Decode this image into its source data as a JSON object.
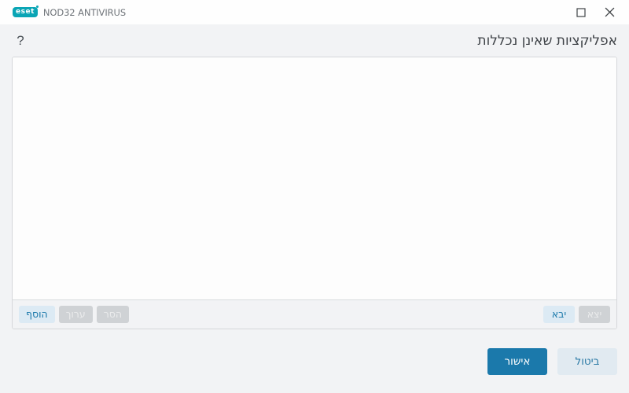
{
  "titlebar": {
    "close_label": "close-icon",
    "maximize_label": "maximize-icon",
    "brand_logo_text": "eset",
    "brand_product": "NOD32 ANTIVIRUS",
    "brand_color": "#0aa5b5",
    "background": "#fefefe"
  },
  "header": {
    "title": "אפליקציות שאינן נכללות",
    "help_label": "?"
  },
  "panel": {
    "list": {
      "items": [],
      "empty": ""
    },
    "toolbar": {
      "right_group": [
        {
          "label": "הוסף",
          "state": "enabled"
        },
        {
          "label": "ערוך",
          "state": "disabled"
        },
        {
          "label": "הסר",
          "state": "disabled"
        }
      ],
      "left_group": [
        {
          "label": "יבא",
          "state": "enabled"
        },
        {
          "label": "יצא",
          "state": "disabled"
        }
      ]
    }
  },
  "footer": {
    "confirm_label": "אישור",
    "cancel_label": "ביטול"
  },
  "colors": {
    "accent": "#1b79ab",
    "accent_soft": "#dceaf4",
    "page_background": "#f2f3f5",
    "panel_background": "#ffffff",
    "disabled_background": "#cfd2d5",
    "border": "#d5d7da"
  }
}
